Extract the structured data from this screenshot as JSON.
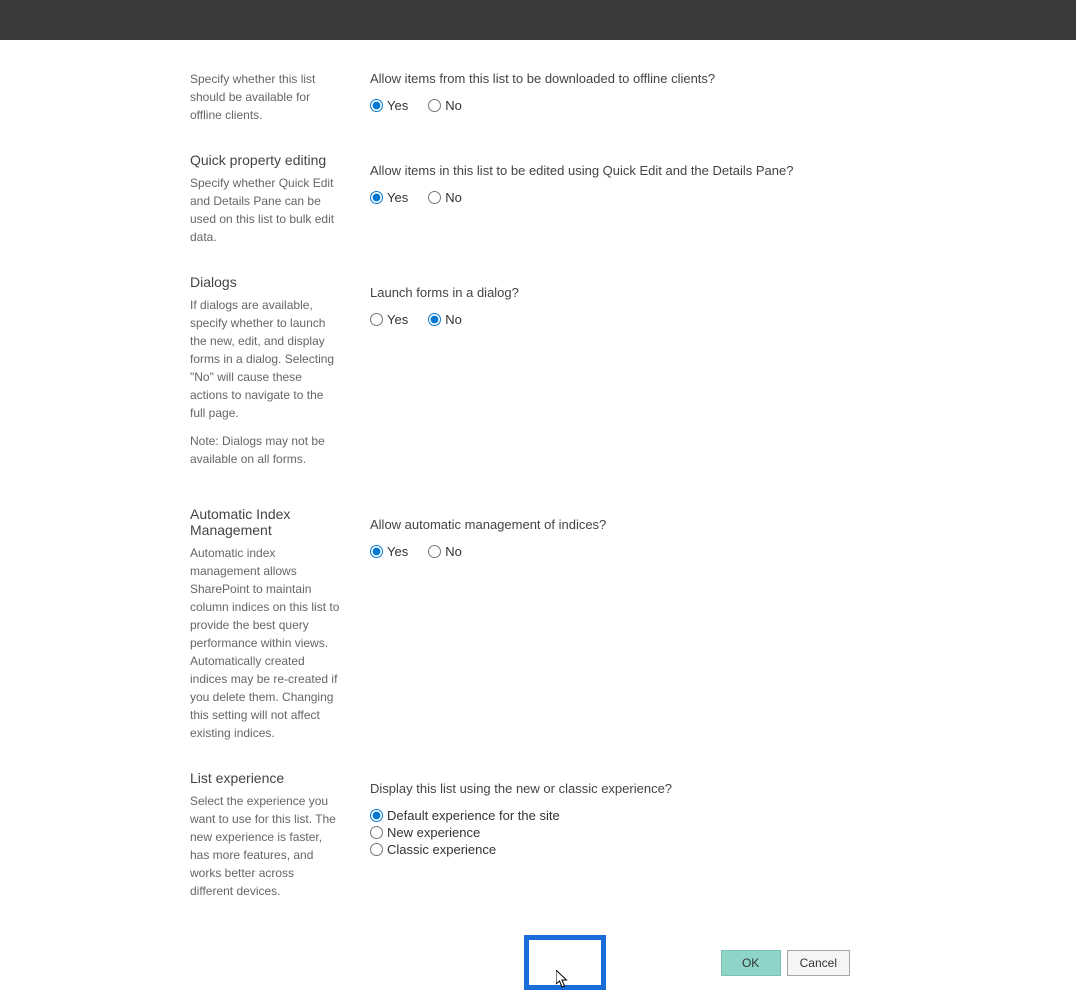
{
  "sections": {
    "offline": {
      "description": "Specify whether this list should be available for offline clients.",
      "question": "Allow items from this list to be downloaded to offline clients?",
      "yes": "Yes",
      "no": "No",
      "selected": "yes"
    },
    "quickEdit": {
      "title": "Quick property editing",
      "description": "Specify whether Quick Edit and Details Pane can be used on this list to bulk edit data.",
      "question": "Allow items in this list to be edited using Quick Edit and the Details Pane?",
      "yes": "Yes",
      "no": "No",
      "selected": "yes"
    },
    "dialogs": {
      "title": "Dialogs",
      "description": "If dialogs are available, specify whether to launch the new, edit, and display forms in a dialog. Selecting \"No\" will cause these actions to navigate to the full page.",
      "note": "Note: Dialogs may not be available on all forms.",
      "question": "Launch forms in a dialog?",
      "yes": "Yes",
      "no": "No",
      "selected": "no"
    },
    "indexManagement": {
      "title": "Automatic Index Management",
      "description": "Automatic index management allows SharePoint to maintain column indices on this list to provide the best query performance within views. Automatically created indices may be re-created if you delete them. Changing this setting will not affect existing indices.",
      "question": "Allow automatic management of indices?",
      "yes": "Yes",
      "no": "No",
      "selected": "yes"
    },
    "listExperience": {
      "title": "List experience",
      "description": "Select the experience you want to use for this list. The new experience is faster, has more features, and works better across different devices.",
      "question": "Display this list using the new or classic experience?",
      "options": {
        "default": "Default experience for the site",
        "new": "New experience",
        "classic": "Classic experience"
      },
      "selected": "default"
    }
  },
  "buttons": {
    "ok": "OK",
    "cancel": "Cancel"
  }
}
